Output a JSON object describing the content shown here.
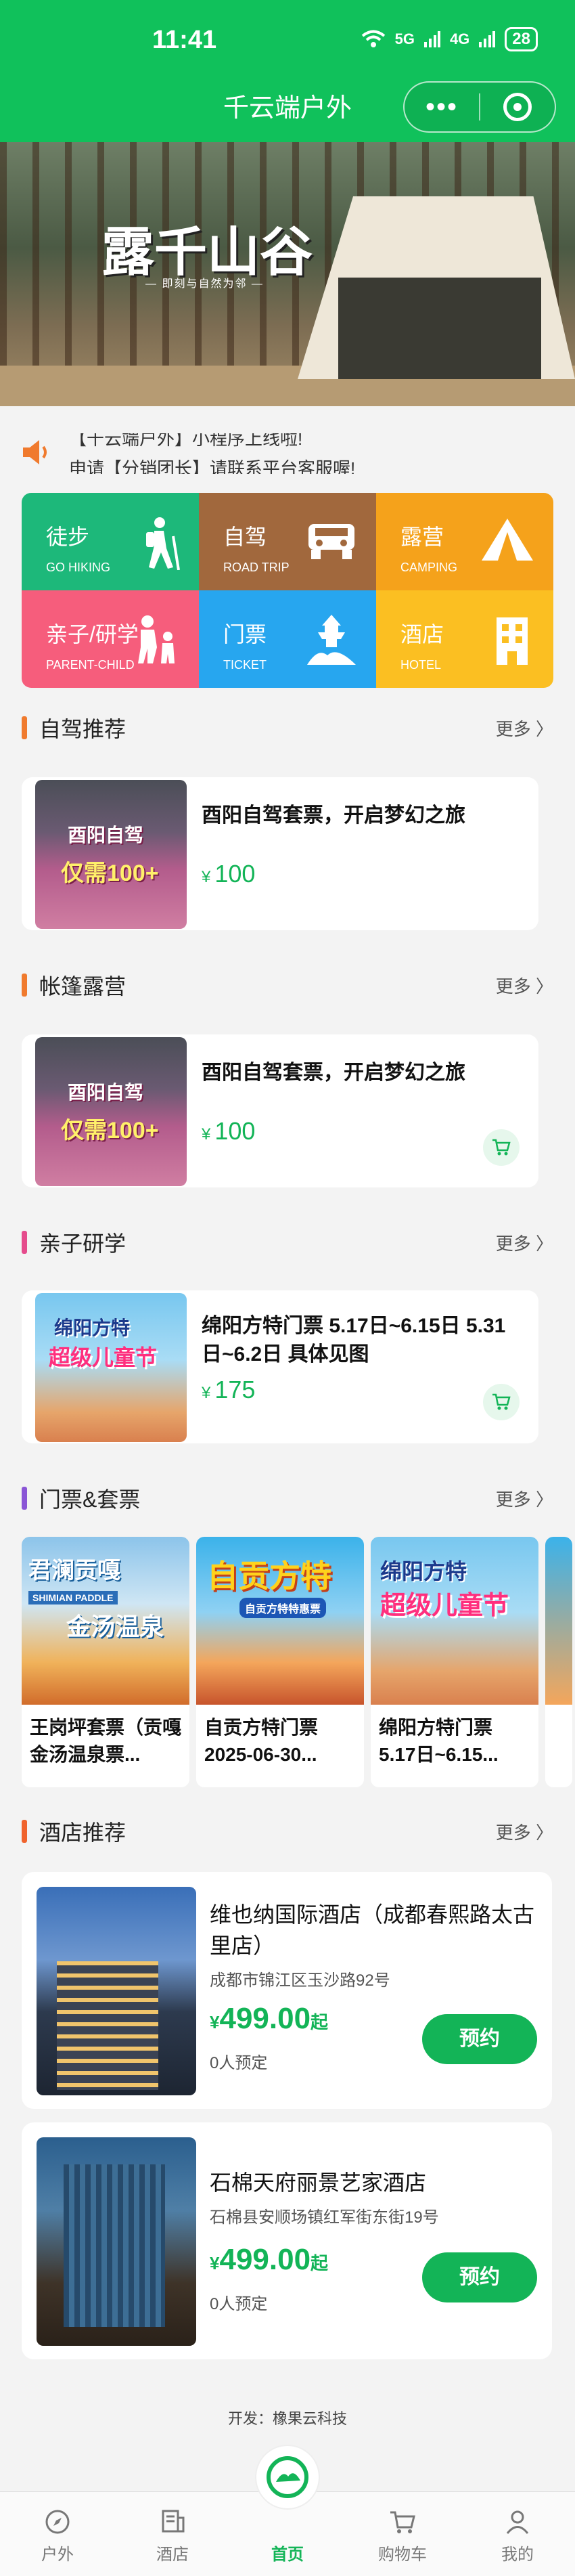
{
  "status": {
    "time": "11:41",
    "signal1": "5G",
    "signal2": "4G",
    "battery": "28"
  },
  "header": {
    "title": "千云端户外"
  },
  "banner": {
    "title": "露千山谷",
    "subtitle": "— 即刻与自然为邻 —"
  },
  "notice": {
    "line1": "【千云端户外】小程序上线啦!",
    "line2": "申请【分销团长】请联系平台客服喔!"
  },
  "categories": [
    {
      "label": "徒步",
      "en": "GO HIKING",
      "color": "#1db87a",
      "icon": "hiker-icon"
    },
    {
      "label": "自驾",
      "en": "ROAD TRIP",
      "color": "#a1683d",
      "icon": "jeep-icon"
    },
    {
      "label": "露营",
      "en": "CAMPING",
      "color": "#f5a21b",
      "icon": "tent-icon"
    },
    {
      "label": "亲子/研学",
      "en": "PARENT-CHILD",
      "color": "#f65d7c",
      "icon": "family-icon"
    },
    {
      "label": "门票",
      "en": "TICKET",
      "color": "#27a6ef",
      "icon": "pagoda-icon"
    },
    {
      "label": "酒店",
      "en": "HOTEL",
      "color": "#fbbf22",
      "icon": "building-icon"
    }
  ],
  "sections": {
    "self_drive": {
      "title": "自驾推荐",
      "more": "更多 〉",
      "accent": "#f07a2d"
    },
    "camping": {
      "title": "帐篷露营",
      "more": "更多 〉",
      "accent": "#f07a2d"
    },
    "parent_child": {
      "title": "亲子研学",
      "more": "更多 〉",
      "accent": "#e54b8c"
    },
    "tickets": {
      "title": "门票&套票",
      "more": "更多 〉",
      "accent": "#8a55d6"
    },
    "hotels": {
      "title": "酒店推荐",
      "more": "更多 〉",
      "accent": "#f0632d"
    }
  },
  "products": {
    "self_drive": {
      "name": "酉阳自驾套票，开启梦幻之旅",
      "currency": "¥",
      "price": "100",
      "img_text1": "酉阳自驾",
      "img_text2": "仅需100+"
    },
    "camping": {
      "name": "酉阳自驾套票，开启梦幻之旅",
      "currency": "¥",
      "price": "100",
      "img_text1": "酉阳自驾",
      "img_text2": "仅需100+"
    },
    "parent_child": {
      "name": "绵阳方特门票 5.17日~6.15日 5.31日~6.2日 具体见图",
      "currency": "¥",
      "price": "175",
      "img_text1": "绵阳方特",
      "img_text2": "超级儿童节"
    }
  },
  "tickets": [
    {
      "title": "王岗坪套票（贡嘎金汤温泉票...",
      "img_text1": "君澜贡嘎",
      "img_text2": "金汤温泉",
      "img_text3": "SHIMIAN PADDLE"
    },
    {
      "title": "自贡方特门票 2025-06-30...",
      "img_text1": "自贡方特",
      "img_text2": "自贡方特特惠票"
    },
    {
      "title": "绵阳方特门票 5.17日~6.15...",
      "img_text1": "绵阳方特",
      "img_text2": "超级儿童节"
    }
  ],
  "hotels": [
    {
      "name": "维也纳国际酒店（成都春熙路太古里店）",
      "address": "成都市锦江区玉沙路92号",
      "currency": "¥",
      "price": "499.00",
      "suffix": "起",
      "booked": "0人预定",
      "button": "预约"
    },
    {
      "name": "石棉天府丽景艺家酒店",
      "address": "石棉县安顺场镇红军街东街19号",
      "currency": "¥",
      "price": "499.00",
      "suffix": "起",
      "booked": "0人预定",
      "button": "预约"
    }
  ],
  "footer": {
    "developer": "开发：橡果云科技"
  },
  "tabbar": [
    {
      "label": "户外",
      "icon": "compass-icon"
    },
    {
      "label": "酒店",
      "icon": "hotel-doc-icon"
    },
    {
      "label": "首页",
      "icon": "home-logo-icon"
    },
    {
      "label": "购物车",
      "icon": "cart-icon"
    },
    {
      "label": "我的",
      "icon": "user-icon"
    }
  ],
  "colors": {
    "brand": "#10c15b",
    "price": "#13b457"
  }
}
